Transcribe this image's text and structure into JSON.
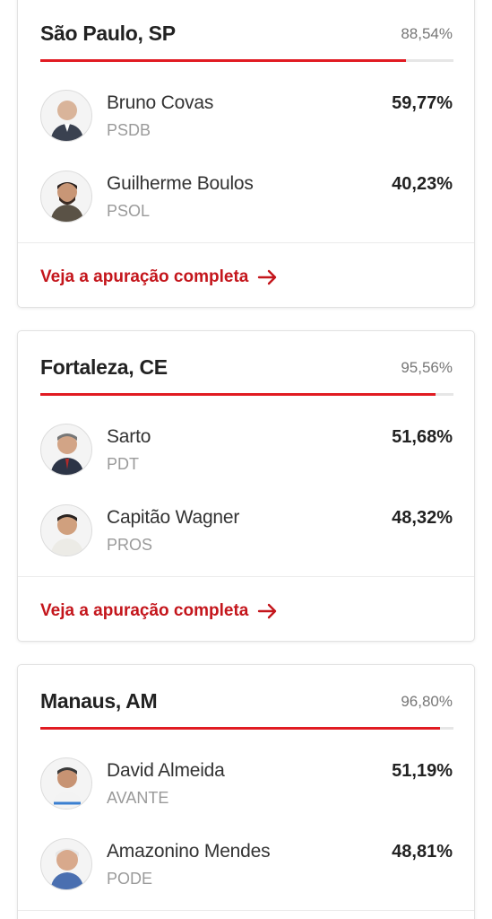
{
  "colors": {
    "accent": "#e11b22",
    "link": "#c4161c",
    "track": "#e6e6e6"
  },
  "link_label": "Veja a apuração completa",
  "cities": [
    {
      "name": "São Paulo, SP",
      "counted": "88,54%",
      "counted_fraction": 0.8854,
      "candidates": [
        {
          "name": "Bruno Covas",
          "party": "PSDB",
          "percent": "59,77%",
          "icon": "candidate-photo-icon"
        },
        {
          "name": "Guilherme Boulos",
          "party": "PSOL",
          "percent": "40,23%",
          "icon": "candidate-photo-icon"
        }
      ]
    },
    {
      "name": "Fortaleza, CE",
      "counted": "95,56%",
      "counted_fraction": 0.9556,
      "candidates": [
        {
          "name": "Sarto",
          "party": "PDT",
          "percent": "51,68%",
          "icon": "candidate-photo-icon"
        },
        {
          "name": "Capitão Wagner",
          "party": "PROS",
          "percent": "48,32%",
          "icon": "candidate-photo-icon"
        }
      ]
    },
    {
      "name": "Manaus, AM",
      "counted": "96,80%",
      "counted_fraction": 0.968,
      "candidates": [
        {
          "name": "David Almeida",
          "party": "AVANTE",
          "percent": "51,19%",
          "icon": "candidate-photo-icon"
        },
        {
          "name": "Amazonino Mendes",
          "party": "PODE",
          "percent": "48,81%",
          "icon": "candidate-photo-icon"
        }
      ]
    }
  ]
}
